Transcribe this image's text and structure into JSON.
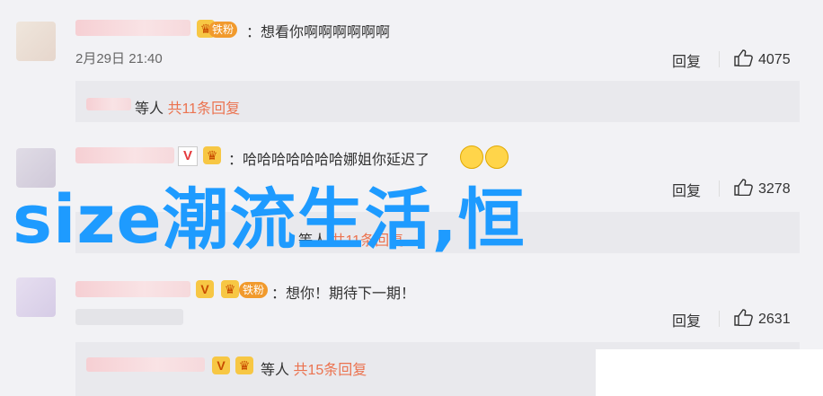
{
  "comments": [
    {
      "text": "：想看你啊啊啊啊啊啊",
      "timestamp": "2月29日 21:40",
      "reply_label": "回复",
      "likes": "4075",
      "reply_summary": {
        "prefix": "等人",
        "link": "共11条回复"
      }
    },
    {
      "text": "：哈哈哈哈哈哈哈娜姐你延迟了",
      "timestamp": "",
      "reply_label": "回复",
      "likes": "3278",
      "reply_summary": {
        "prefix": "等人",
        "link": "共11条回复"
      }
    },
    {
      "text": "：想你！期待下一期！",
      "timestamp": "",
      "reply_label": "回复",
      "likes": "2631",
      "reply_summary": {
        "prefix": "等人",
        "link": "共15条回复"
      }
    }
  ],
  "badges": {
    "fan": "铁粉",
    "v": "V"
  },
  "watermark": "size潮流生活,恒",
  "colors": {
    "link": "#eb7350",
    "watermark": "#1e9bff",
    "badge_fan": "#f19a2d"
  }
}
